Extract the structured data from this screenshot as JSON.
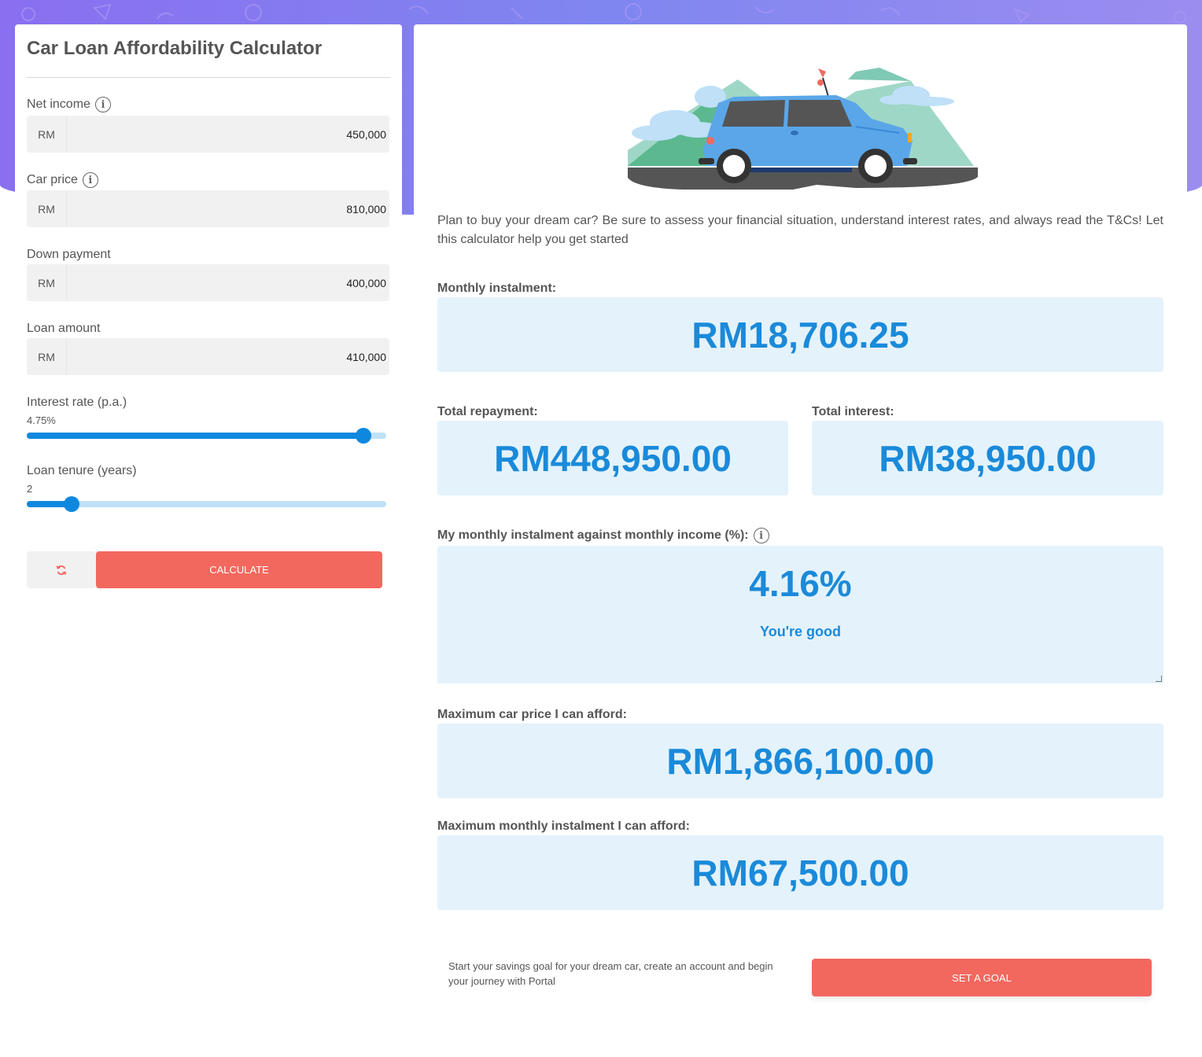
{
  "calculator": {
    "title": "Car Loan Affordability Calculator",
    "fields": {
      "net_income": {
        "label": "Net income",
        "prefix": "RM",
        "value": "450,000"
      },
      "car_price": {
        "label": "Car price",
        "prefix": "RM",
        "value": "810,000"
      },
      "down_payment": {
        "label": "Down payment",
        "prefix": "RM",
        "value": "400,000"
      },
      "loan_amount": {
        "label": "Loan amount",
        "prefix": "RM",
        "value": "410,000"
      }
    },
    "interest_rate": {
      "label": "Interest rate (p.a.)",
      "value_text": "4.75%",
      "fill_fraction": 0.937
    },
    "loan_tenure": {
      "label": "Loan tenure (years)",
      "value_text": "2",
      "fill_fraction": 0.125
    },
    "reset_icon": "refresh-icon",
    "calculate_label": "CALCULATE"
  },
  "results": {
    "intro": "Plan to buy your dream car? Be sure to assess your financial situation, understand interest rates, and always read the T&Cs! Let this calculator help you get started",
    "monthly_instalment": {
      "label": "Monthly instalment:",
      "value": "RM18,706.25"
    },
    "total_repayment": {
      "label": "Total repayment:",
      "value": "RM448,950.00"
    },
    "total_interest": {
      "label": "Total interest:",
      "value": "RM38,950.00"
    },
    "instalment_vs_income": {
      "label": "My monthly instalment against monthly income (%):",
      "value": "4.16%",
      "status": "You're good"
    },
    "max_car_price": {
      "label": "Maximum car price I can afford:",
      "value": "RM1,866,100.00"
    },
    "max_monthly_instalment": {
      "label": "Maximum monthly instalment I can afford:",
      "value": "RM67,500.00"
    }
  },
  "goal": {
    "text": "Start your savings goal for your dream car, create an account and begin your journey with Portal",
    "button_label": "SET A GOAL"
  },
  "colors": {
    "accent": "#f2685e",
    "result_text": "#1a8ada",
    "result_bg": "#e4f2fb",
    "slider": "#0e88de"
  }
}
